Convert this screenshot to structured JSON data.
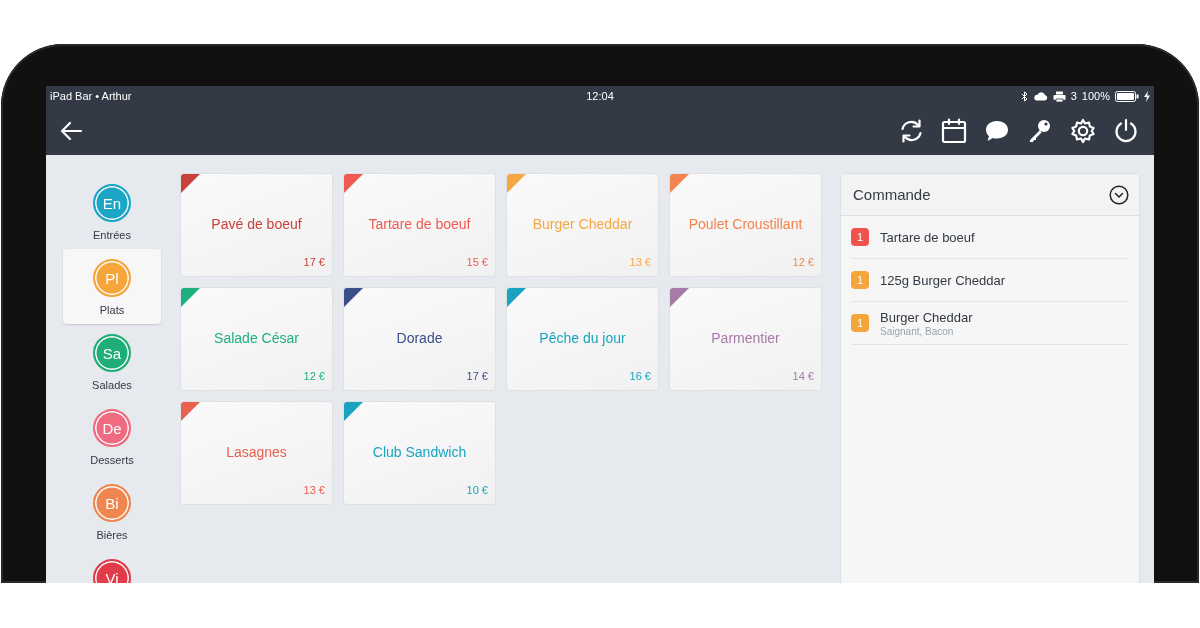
{
  "status_bar": {
    "device": "iPad Bar • Arthur",
    "time": "12:04",
    "printer_count": "3",
    "battery": "100%"
  },
  "categories": [
    {
      "initials": "En",
      "label": "Entrées",
      "color": "#1aa6c4",
      "selected": false
    },
    {
      "initials": "Pl",
      "label": "Plats",
      "color": "#f5a53a",
      "selected": true
    },
    {
      "initials": "Sa",
      "label": "Salades",
      "color": "#1fae78",
      "selected": false
    },
    {
      "initials": "De",
      "label": "Desserts",
      "color": "#f06a80",
      "selected": false
    },
    {
      "initials": "Bi",
      "label": "Bières",
      "color": "#ef8650",
      "selected": false
    },
    {
      "initials": "Vi",
      "color": "#e23c4b",
      "selected": false
    }
  ],
  "products": [
    {
      "name": "Pavé de boeuf",
      "price": "17 €",
      "color": "#c8413b"
    },
    {
      "name": "Tartare de boeuf",
      "price": "15 €",
      "color": "#ee5a52"
    },
    {
      "name": "Burger Cheddar",
      "price": "13 €",
      "color": "#f5a742"
    },
    {
      "name": "Poulet Croustillant",
      "price": "12 €",
      "color": "#f08550"
    },
    {
      "name": "Salade César",
      "price": "12 €",
      "color": "#1db07e"
    },
    {
      "name": "Dorade",
      "price": "17 €",
      "color": "#3a4f8a"
    },
    {
      "name": "Pêche du jour",
      "price": "16 €",
      "color": "#1aa3c0"
    },
    {
      "name": "Parmentier",
      "price": "14 €",
      "color": "#a77aa8"
    },
    {
      "name": "Lasagnes",
      "price": "13 €",
      "color": "#e8604e"
    },
    {
      "name": "Club Sandwich",
      "price": "10 €",
      "color": "#1aa3c0"
    }
  ],
  "order": {
    "title": "Commande",
    "items": [
      {
        "quantity": "1",
        "name": "Tartare de boeuf",
        "color": "#f0534f"
      },
      {
        "quantity": "1",
        "name": "125g Burger Cheddar",
        "color": "#f5a53a"
      },
      {
        "quantity": "1",
        "name": "Burger Cheddar",
        "note": "Saignant, Bacon",
        "color": "#f5a53a"
      }
    ]
  }
}
